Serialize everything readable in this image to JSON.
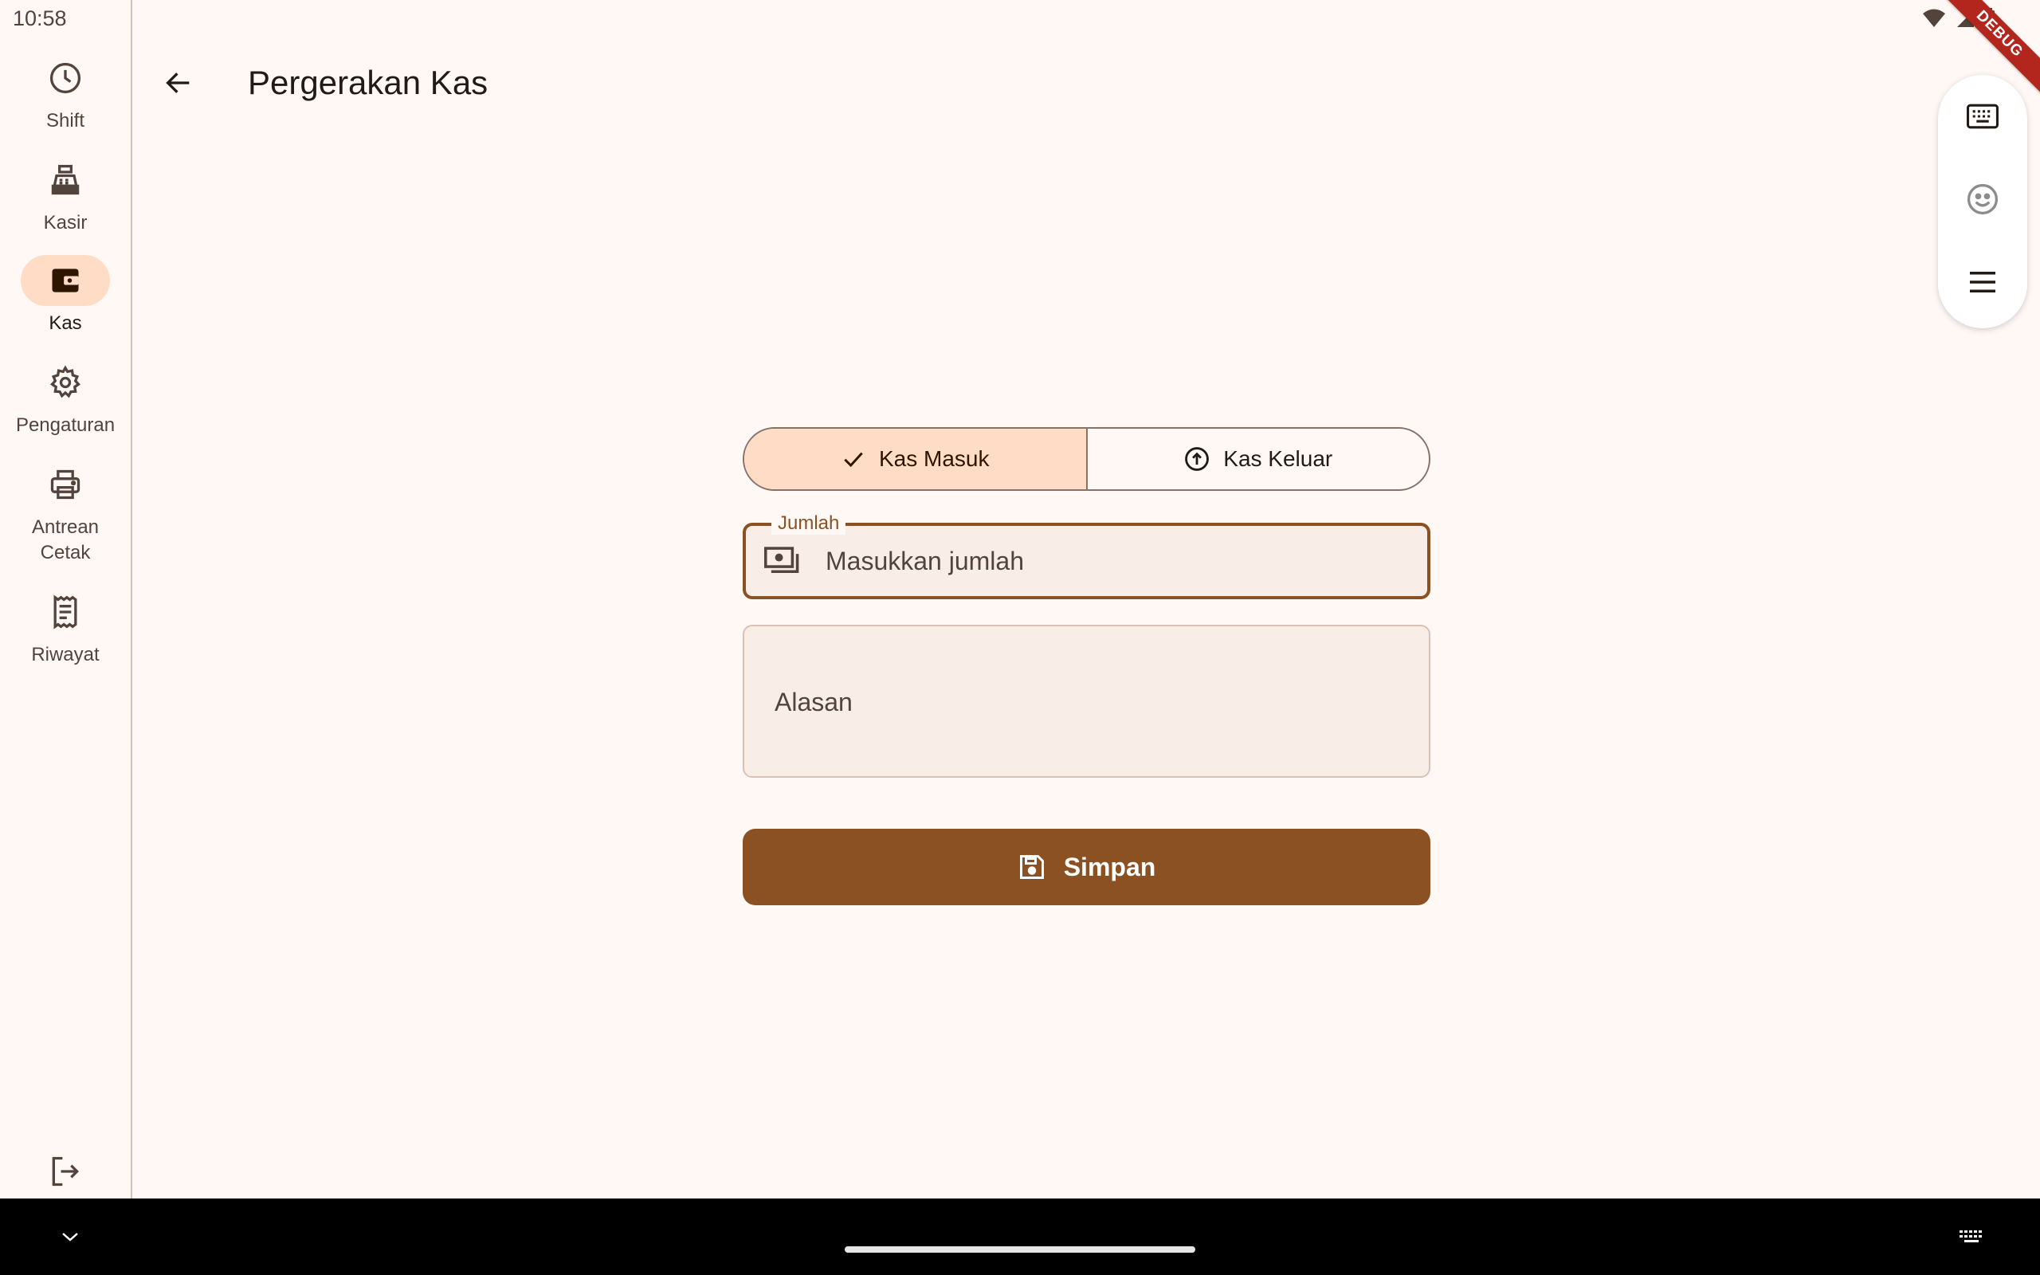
{
  "status_bar": {
    "time": "10:58",
    "debug_label": "DEBUG"
  },
  "nav_rail": {
    "items": [
      {
        "id": "shift",
        "label": "Shift",
        "icon": "clock-icon",
        "active": false
      },
      {
        "id": "kasir",
        "label": "Kasir",
        "icon": "cash-register-icon",
        "active": false
      },
      {
        "id": "kas",
        "label": "Kas",
        "icon": "wallet-icon",
        "active": true
      },
      {
        "id": "pengaturan",
        "label": "Pengaturan",
        "icon": "gear-icon",
        "active": false
      },
      {
        "id": "antrean-cetak",
        "label": "Antrean Cetak",
        "icon": "printer-icon",
        "active": false
      },
      {
        "id": "riwayat",
        "label": "Riwayat",
        "icon": "receipt-icon",
        "active": false
      }
    ],
    "logout_icon": "logout-icon"
  },
  "app_bar": {
    "title": "Pergerakan Kas",
    "back_icon": "arrow-back-icon"
  },
  "form": {
    "segments": [
      {
        "label": "Kas Masuk",
        "icon": "check-icon",
        "selected": true
      },
      {
        "label": "Kas Keluar",
        "icon": "arrow-up-circle-icon",
        "selected": false
      }
    ],
    "amount": {
      "label": "Jumlah",
      "placeholder": "Masukkan jumlah",
      "value": "",
      "icon": "payments-icon"
    },
    "reason": {
      "placeholder": "Alasan",
      "value": ""
    },
    "save": {
      "label": "Simpan",
      "icon": "save-icon"
    }
  },
  "ime_toolbar": {
    "buttons": [
      "keyboard-icon",
      "emoji-icon",
      "menu-icon"
    ]
  },
  "colors": {
    "background": "#FFF8F5",
    "primary": "#8B5122",
    "primary_container": "#FFDCC6",
    "field_fill": "#F9EDE8",
    "outline": "#85736A",
    "on_surface": "#221A15"
  }
}
